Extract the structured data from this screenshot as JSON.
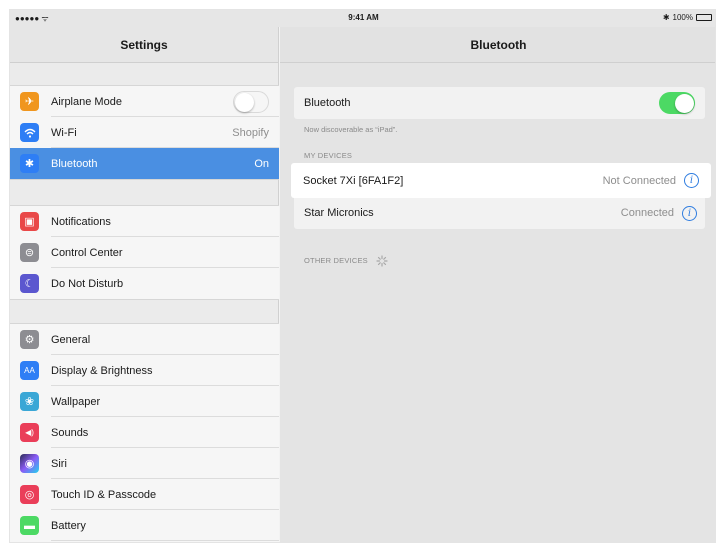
{
  "status": {
    "signal": "●●●●● ᯤ",
    "time": "9:41 AM",
    "bluetooth_glyph": "✱",
    "battery": "100%"
  },
  "left": {
    "title": "Settings",
    "group1": [
      {
        "icon": "airplane-icon",
        "glyph": "✈",
        "color": "#f0961e",
        "label": "Airplane Mode",
        "value": "",
        "toggle": "off"
      },
      {
        "icon": "wifi-icon",
        "glyph": "≋",
        "color": "#2e7ef5",
        "label": "Wi-Fi",
        "value": "Shopify"
      },
      {
        "icon": "bluetooth-icon",
        "glyph": "✱",
        "color": "#2e7ef5",
        "label": "Bluetooth",
        "value": "On",
        "selected": true
      }
    ],
    "group2": [
      {
        "icon": "notifications-icon",
        "glyph": "▣",
        "color": "#e94848",
        "label": "Notifications"
      },
      {
        "icon": "control-center-icon",
        "glyph": "⊜",
        "color": "#8d8d92",
        "label": "Control Center"
      },
      {
        "icon": "do-not-disturb-icon",
        "glyph": "☾",
        "color": "#5b57cf",
        "label": "Do Not Disturb"
      }
    ],
    "group3": [
      {
        "icon": "general-icon",
        "glyph": "⚙",
        "color": "#8d8d92",
        "label": "General"
      },
      {
        "icon": "display-brightness-icon",
        "glyph": "AA",
        "color": "#2e7ef5",
        "label": "Display & Brightness"
      },
      {
        "icon": "wallpaper-icon",
        "glyph": "❀",
        "color": "#3aa7d6",
        "label": "Wallpaper"
      },
      {
        "icon": "sounds-icon",
        "glyph": "◀)",
        "color": "#ea3e59",
        "label": "Sounds"
      },
      {
        "icon": "siri-icon",
        "glyph": "◉",
        "color": "#2b2b55",
        "label": "Siri"
      },
      {
        "icon": "touch-id-icon",
        "glyph": "◎",
        "color": "#ea3e59",
        "label": "Touch ID & Passcode"
      },
      {
        "icon": "battery-icon",
        "glyph": "▬",
        "color": "#4cd964",
        "label": "Battery"
      }
    ]
  },
  "right": {
    "title": "Bluetooth",
    "bluetooth_label": "Bluetooth",
    "bluetooth_toggle": "on",
    "discoverable": "Now discoverable as “iPad”.",
    "my_devices_header": "MY DEVICES",
    "devices": [
      {
        "name": "Socket 7Xi [6FA1F2]",
        "status": "Not Connected",
        "highlighted": true
      },
      {
        "name": "Star Micronics",
        "status": "Connected"
      }
    ],
    "other_devices_header": "OTHER DEVICES",
    "info_glyph": "i"
  },
  "colors": {
    "accent": "#4a8fe2",
    "toggle_on": "#4cd964",
    "info_blue": "#2f7de0"
  }
}
